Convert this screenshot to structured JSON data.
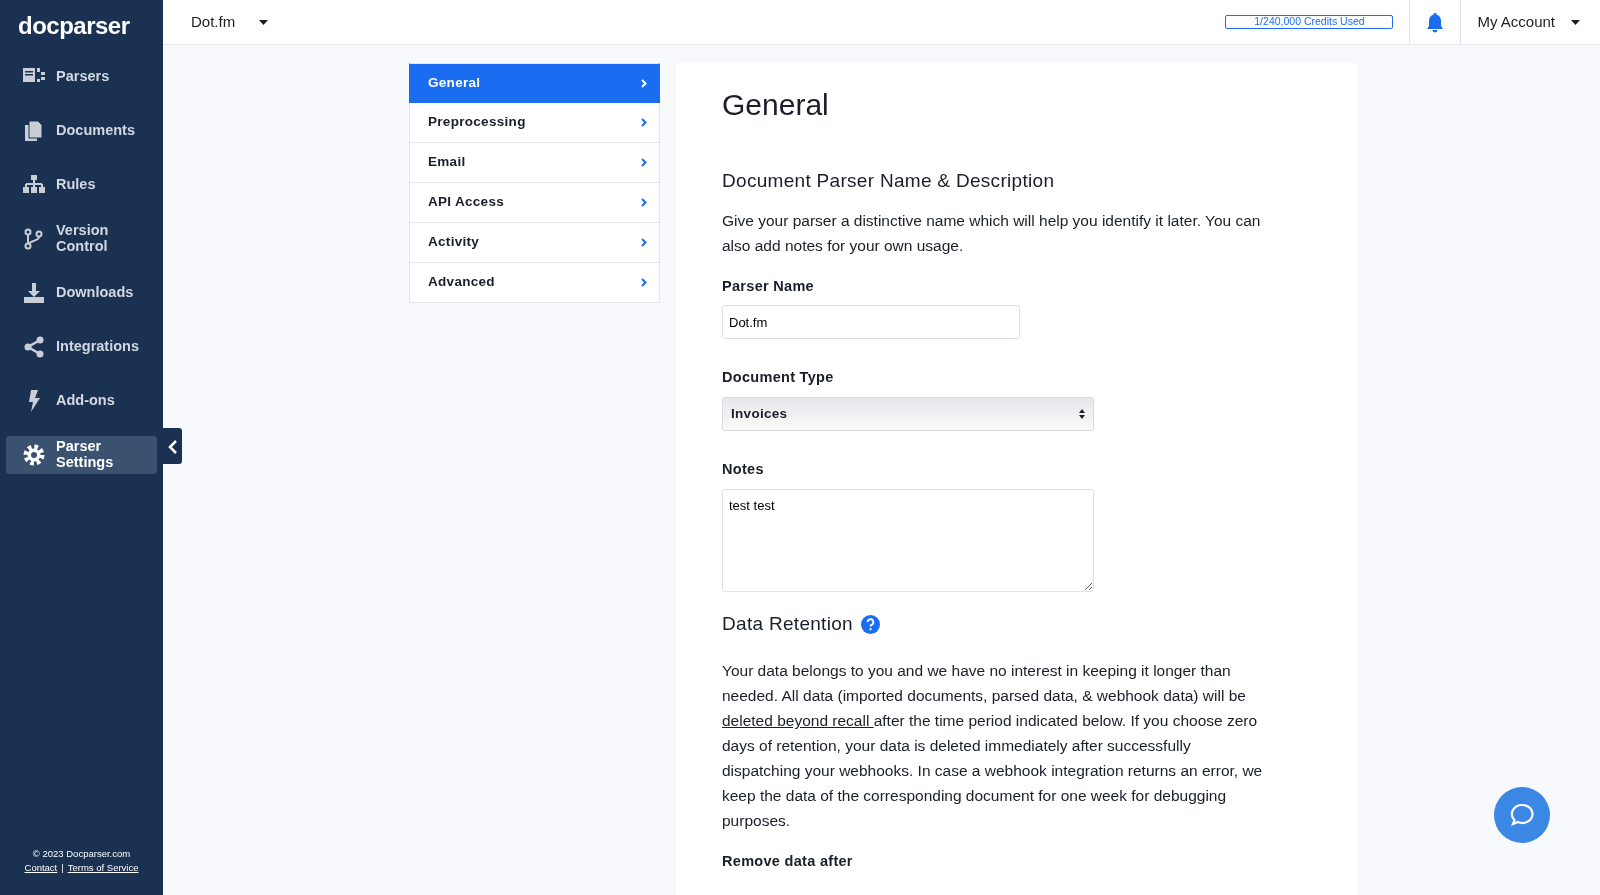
{
  "brand": "docparser",
  "sidebar": {
    "items": [
      {
        "label": "Parsers",
        "kind": "parsers",
        "selected": false
      },
      {
        "label": "Documents",
        "kind": "documents",
        "selected": false
      },
      {
        "label": "Rules",
        "kind": "rules",
        "selected": false
      },
      {
        "label": "Version Control",
        "kind": "branch",
        "selected": false
      },
      {
        "label": "Downloads",
        "kind": "download",
        "selected": false
      },
      {
        "label": "Integrations",
        "kind": "share",
        "selected": false
      },
      {
        "label": "Add-ons",
        "kind": "bolt",
        "selected": false
      },
      {
        "label": "Parser Settings",
        "kind": "gear",
        "selected": true
      }
    ],
    "footer": {
      "copyright": "© 2023 Docparser.com",
      "links": [
        "Contact",
        "Terms of Service"
      ],
      "separator": "|"
    }
  },
  "topbar": {
    "parser": "Dot.fm",
    "credits": {
      "text": "1/240,000 Credits Used"
    },
    "account": "My Account"
  },
  "settings_menu": [
    {
      "label": "General",
      "selected": true
    },
    {
      "label": "Preprocessing",
      "selected": false
    },
    {
      "label": "Email",
      "selected": false
    },
    {
      "label": "API Access",
      "selected": false
    },
    {
      "label": "Activity",
      "selected": false
    },
    {
      "label": "Advanced",
      "selected": false
    }
  ],
  "content": {
    "title": "General",
    "section_title": "Document Parser Name & Description",
    "intro": "Give your parser a distinctive name which will help you identify it later. You can also add notes for your own usage.",
    "parser_name": {
      "label": "Parser Name",
      "value": "Dot.fm"
    },
    "document_type": {
      "label": "Document Type",
      "value": "Invoices"
    },
    "notes": {
      "label": "Notes",
      "value": "test test"
    },
    "retention": {
      "title": "Data Retention",
      "text_before": "Your data belongs to you and we have no interest in keeping it longer than needed. All data (imported documents, parsed data, & webhook data) will be ",
      "link": "deleted beyond recall ",
      "text_after": "after the time period indicated below. If you choose zero days of retention, your data is deleted immediately after successfully dispatching your webhooks. In case a webhook integration returns an error, we keep the data of the corresponding document for one week for debugging purposes.",
      "remove_label": "Remove data after"
    }
  }
}
